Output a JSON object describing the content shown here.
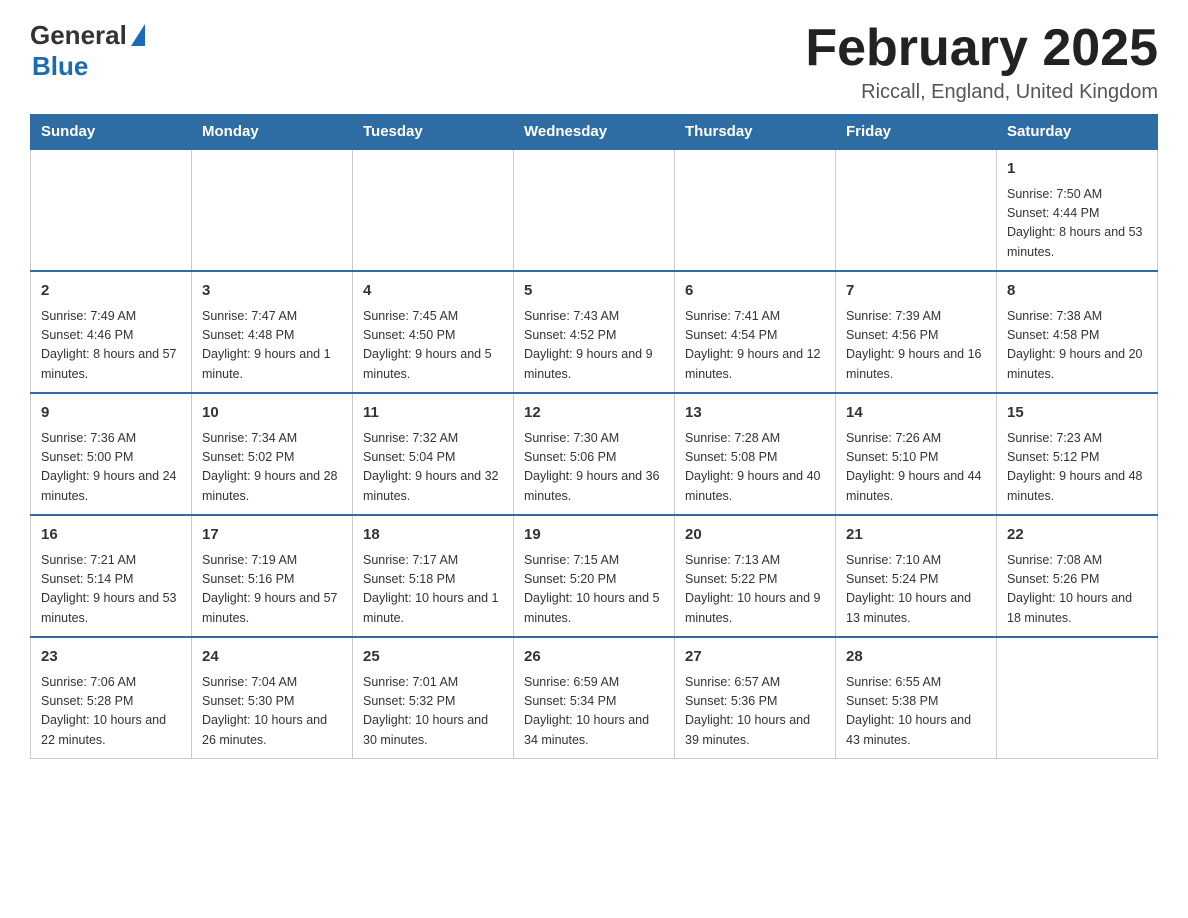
{
  "header": {
    "logo_general": "General",
    "logo_blue": "Blue",
    "month_title": "February 2025",
    "location": "Riccall, England, United Kingdom"
  },
  "weekdays": [
    "Sunday",
    "Monday",
    "Tuesday",
    "Wednesday",
    "Thursday",
    "Friday",
    "Saturday"
  ],
  "weeks": [
    [
      {
        "day": "",
        "sunrise": "",
        "sunset": "",
        "daylight": "",
        "empty": true
      },
      {
        "day": "",
        "sunrise": "",
        "sunset": "",
        "daylight": "",
        "empty": true
      },
      {
        "day": "",
        "sunrise": "",
        "sunset": "",
        "daylight": "",
        "empty": true
      },
      {
        "day": "",
        "sunrise": "",
        "sunset": "",
        "daylight": "",
        "empty": true
      },
      {
        "day": "",
        "sunrise": "",
        "sunset": "",
        "daylight": "",
        "empty": true
      },
      {
        "day": "",
        "sunrise": "",
        "sunset": "",
        "daylight": "",
        "empty": true
      },
      {
        "day": "1",
        "sunrise": "Sunrise: 7:50 AM",
        "sunset": "Sunset: 4:44 PM",
        "daylight": "Daylight: 8 hours and 53 minutes.",
        "empty": false
      }
    ],
    [
      {
        "day": "2",
        "sunrise": "Sunrise: 7:49 AM",
        "sunset": "Sunset: 4:46 PM",
        "daylight": "Daylight: 8 hours and 57 minutes.",
        "empty": false
      },
      {
        "day": "3",
        "sunrise": "Sunrise: 7:47 AM",
        "sunset": "Sunset: 4:48 PM",
        "daylight": "Daylight: 9 hours and 1 minute.",
        "empty": false
      },
      {
        "day": "4",
        "sunrise": "Sunrise: 7:45 AM",
        "sunset": "Sunset: 4:50 PM",
        "daylight": "Daylight: 9 hours and 5 minutes.",
        "empty": false
      },
      {
        "day": "5",
        "sunrise": "Sunrise: 7:43 AM",
        "sunset": "Sunset: 4:52 PM",
        "daylight": "Daylight: 9 hours and 9 minutes.",
        "empty": false
      },
      {
        "day": "6",
        "sunrise": "Sunrise: 7:41 AM",
        "sunset": "Sunset: 4:54 PM",
        "daylight": "Daylight: 9 hours and 12 minutes.",
        "empty": false
      },
      {
        "day": "7",
        "sunrise": "Sunrise: 7:39 AM",
        "sunset": "Sunset: 4:56 PM",
        "daylight": "Daylight: 9 hours and 16 minutes.",
        "empty": false
      },
      {
        "day": "8",
        "sunrise": "Sunrise: 7:38 AM",
        "sunset": "Sunset: 4:58 PM",
        "daylight": "Daylight: 9 hours and 20 minutes.",
        "empty": false
      }
    ],
    [
      {
        "day": "9",
        "sunrise": "Sunrise: 7:36 AM",
        "sunset": "Sunset: 5:00 PM",
        "daylight": "Daylight: 9 hours and 24 minutes.",
        "empty": false
      },
      {
        "day": "10",
        "sunrise": "Sunrise: 7:34 AM",
        "sunset": "Sunset: 5:02 PM",
        "daylight": "Daylight: 9 hours and 28 minutes.",
        "empty": false
      },
      {
        "day": "11",
        "sunrise": "Sunrise: 7:32 AM",
        "sunset": "Sunset: 5:04 PM",
        "daylight": "Daylight: 9 hours and 32 minutes.",
        "empty": false
      },
      {
        "day": "12",
        "sunrise": "Sunrise: 7:30 AM",
        "sunset": "Sunset: 5:06 PM",
        "daylight": "Daylight: 9 hours and 36 minutes.",
        "empty": false
      },
      {
        "day": "13",
        "sunrise": "Sunrise: 7:28 AM",
        "sunset": "Sunset: 5:08 PM",
        "daylight": "Daylight: 9 hours and 40 minutes.",
        "empty": false
      },
      {
        "day": "14",
        "sunrise": "Sunrise: 7:26 AM",
        "sunset": "Sunset: 5:10 PM",
        "daylight": "Daylight: 9 hours and 44 minutes.",
        "empty": false
      },
      {
        "day": "15",
        "sunrise": "Sunrise: 7:23 AM",
        "sunset": "Sunset: 5:12 PM",
        "daylight": "Daylight: 9 hours and 48 minutes.",
        "empty": false
      }
    ],
    [
      {
        "day": "16",
        "sunrise": "Sunrise: 7:21 AM",
        "sunset": "Sunset: 5:14 PM",
        "daylight": "Daylight: 9 hours and 53 minutes.",
        "empty": false
      },
      {
        "day": "17",
        "sunrise": "Sunrise: 7:19 AM",
        "sunset": "Sunset: 5:16 PM",
        "daylight": "Daylight: 9 hours and 57 minutes.",
        "empty": false
      },
      {
        "day": "18",
        "sunrise": "Sunrise: 7:17 AM",
        "sunset": "Sunset: 5:18 PM",
        "daylight": "Daylight: 10 hours and 1 minute.",
        "empty": false
      },
      {
        "day": "19",
        "sunrise": "Sunrise: 7:15 AM",
        "sunset": "Sunset: 5:20 PM",
        "daylight": "Daylight: 10 hours and 5 minutes.",
        "empty": false
      },
      {
        "day": "20",
        "sunrise": "Sunrise: 7:13 AM",
        "sunset": "Sunset: 5:22 PM",
        "daylight": "Daylight: 10 hours and 9 minutes.",
        "empty": false
      },
      {
        "day": "21",
        "sunrise": "Sunrise: 7:10 AM",
        "sunset": "Sunset: 5:24 PM",
        "daylight": "Daylight: 10 hours and 13 minutes.",
        "empty": false
      },
      {
        "day": "22",
        "sunrise": "Sunrise: 7:08 AM",
        "sunset": "Sunset: 5:26 PM",
        "daylight": "Daylight: 10 hours and 18 minutes.",
        "empty": false
      }
    ],
    [
      {
        "day": "23",
        "sunrise": "Sunrise: 7:06 AM",
        "sunset": "Sunset: 5:28 PM",
        "daylight": "Daylight: 10 hours and 22 minutes.",
        "empty": false
      },
      {
        "day": "24",
        "sunrise": "Sunrise: 7:04 AM",
        "sunset": "Sunset: 5:30 PM",
        "daylight": "Daylight: 10 hours and 26 minutes.",
        "empty": false
      },
      {
        "day": "25",
        "sunrise": "Sunrise: 7:01 AM",
        "sunset": "Sunset: 5:32 PM",
        "daylight": "Daylight: 10 hours and 30 minutes.",
        "empty": false
      },
      {
        "day": "26",
        "sunrise": "Sunrise: 6:59 AM",
        "sunset": "Sunset: 5:34 PM",
        "daylight": "Daylight: 10 hours and 34 minutes.",
        "empty": false
      },
      {
        "day": "27",
        "sunrise": "Sunrise: 6:57 AM",
        "sunset": "Sunset: 5:36 PM",
        "daylight": "Daylight: 10 hours and 39 minutes.",
        "empty": false
      },
      {
        "day": "28",
        "sunrise": "Sunrise: 6:55 AM",
        "sunset": "Sunset: 5:38 PM",
        "daylight": "Daylight: 10 hours and 43 minutes.",
        "empty": false
      },
      {
        "day": "",
        "sunrise": "",
        "sunset": "",
        "daylight": "",
        "empty": true
      }
    ]
  ]
}
